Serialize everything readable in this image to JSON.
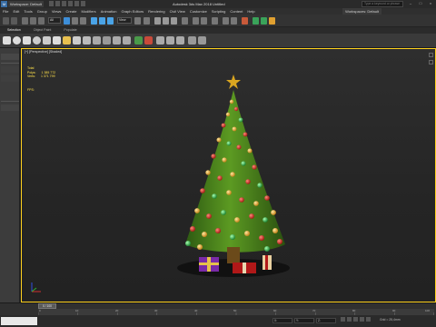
{
  "titlebar": {
    "workspace": "Workspace: Default",
    "title": "Autodesk 3ds Max 2018    Untitled",
    "search_placeholder": "Type a keyword or phrase",
    "controls": [
      "–",
      "□",
      "×"
    ]
  },
  "menubar": {
    "items": [
      "File",
      "Edit",
      "Tools",
      "Group",
      "Views",
      "Create",
      "Modifiers",
      "Animation",
      "Graph Editors",
      "Rendering",
      "Civil View",
      "Customize",
      "Scripting",
      "Content",
      "Help"
    ],
    "workspace_select": "Workspaces: Default"
  },
  "maintoolbar": {
    "filter_value": "All",
    "view_value": "View"
  },
  "ribbon": {
    "tabs": [
      "Selection",
      "Object Paint",
      "Populate"
    ]
  },
  "viewport": {
    "label": "[+] [Perspective] [Shaded]",
    "stats": {
      "title": "Total",
      "polys_label": "Polys:",
      "polys_value": "1 385 772",
      "verts_label": "Verts:",
      "verts_value": "1 371 799"
    },
    "fps_label": "FPS:"
  },
  "timeline": {
    "slider_label": "0 / 100",
    "ticks": [
      "0",
      "10",
      "20",
      "30",
      "40",
      "50",
      "60",
      "70",
      "80",
      "90",
      "100"
    ]
  },
  "statusbar": {
    "grid_text": "Grid = 25,4mm",
    "x_field": "X:",
    "y_field": "Y:",
    "z_field": "Z:"
  },
  "colors": {
    "accent": "#ffd21e",
    "tree": "#3f7a1a",
    "stats": "#ffe14a"
  }
}
